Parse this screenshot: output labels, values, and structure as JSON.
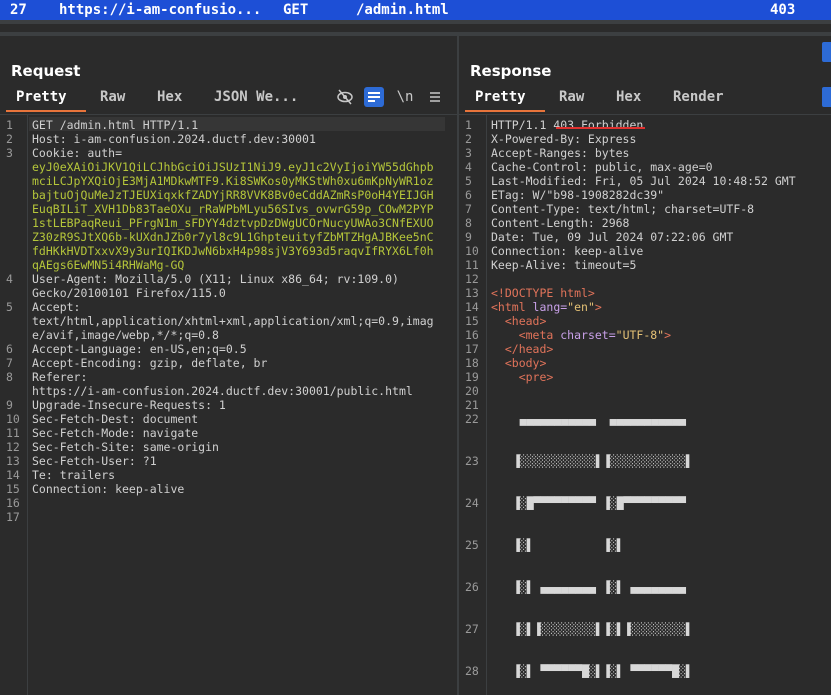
{
  "history_row": {
    "number": "27",
    "host": "https://i-am-confusio...",
    "method": "GET",
    "path": "/admin.html",
    "status": "403"
  },
  "request": {
    "title": "Request",
    "tabs": [
      "Pretty",
      "Raw",
      "Hex",
      "JSON We..."
    ],
    "active_tab": "Pretty",
    "icons": [
      "hide-icon",
      "wrap-lines-icon",
      "newline-icon",
      "menu-icon"
    ],
    "newline_glyph": "\\n",
    "lines": [
      {
        "n": "1",
        "text": "GET /admin.html HTTP/1.1"
      },
      {
        "n": "2",
        "text": "Host: i-am-confusion.2024.ductf.dev:30001"
      },
      {
        "n": "3",
        "text": "Cookie: auth="
      },
      {
        "n": "",
        "text": "eyJ0eXAiOiJKV1QiLCJhbGciOiJSUzI1NiJ9.eyJ1c2VyIjoiYW55dGhpb",
        "cookie": true
      },
      {
        "n": "",
        "text": "mciLCJpYXQiOjE3MjA1MDkwMTF9.Ki8SWKos0yMKStWh0xu6mKpNyWR1oz",
        "cookie": true
      },
      {
        "n": "",
        "text": "bajtuOjQuMeJzTJEUXiqxkfZADYjRR8VVK8Bv0eCddAZmRsP0oH4YEIJGH",
        "cookie": true
      },
      {
        "n": "",
        "text": "EuqBILiT_XVH1Db83TaeOXu_rRaWPbMLyu56SIvs_ovwrG59p_COwM2PYP",
        "cookie": true
      },
      {
        "n": "",
        "text": "1stLEBPaqReui_PFrgN1m_sFDYY4dztvpDzDWgUCOrNucyUWAo3CNfEXUO",
        "cookie": true
      },
      {
        "n": "",
        "text": "Z30zR9SJtXQ6b-kUXdnJZb0r7yl8c9L1GhpteuityfZbMTZHgAJBKee5nC",
        "cookie": true
      },
      {
        "n": "",
        "text": "fdHKkHVDTxxvX9y3urIQIKDJwN6bxH4p98sjV3Y693d5raqvIfRYX6Lf0h",
        "cookie": true
      },
      {
        "n": "",
        "text": "qAEgs6EwMN5i4RHWaMg-GQ",
        "cookie": true
      },
      {
        "n": "4",
        "text": "User-Agent: Mozilla/5.0 (X11; Linux x86_64; rv:109.0)"
      },
      {
        "n": "",
        "text": "Gecko/20100101 Firefox/115.0"
      },
      {
        "n": "5",
        "text": "Accept:"
      },
      {
        "n": "",
        "text": "text/html,application/xhtml+xml,application/xml;q=0.9,imag"
      },
      {
        "n": "",
        "text": "e/avif,image/webp,*/*;q=0.8"
      },
      {
        "n": "6",
        "text": "Accept-Language: en-US,en;q=0.5"
      },
      {
        "n": "7",
        "text": "Accept-Encoding: gzip, deflate, br"
      },
      {
        "n": "8",
        "text": "Referer:"
      },
      {
        "n": "",
        "text": "https://i-am-confusion.2024.ductf.dev:30001/public.html"
      },
      {
        "n": "9",
        "text": "Upgrade-Insecure-Requests: 1"
      },
      {
        "n": "10",
        "text": "Sec-Fetch-Dest: document"
      },
      {
        "n": "11",
        "text": "Sec-Fetch-Mode: navigate"
      },
      {
        "n": "12",
        "text": "Sec-Fetch-Site: same-origin"
      },
      {
        "n": "13",
        "text": "Sec-Fetch-User: ?1"
      },
      {
        "n": "14",
        "text": "Te: trailers"
      },
      {
        "n": "15",
        "text": "Connection: keep-alive"
      },
      {
        "n": "16",
        "text": ""
      },
      {
        "n": "17",
        "text": ""
      }
    ]
  },
  "response": {
    "title": "Response",
    "tabs": [
      "Pretty",
      "Raw",
      "Hex",
      "Render"
    ],
    "active_tab": "Pretty",
    "lines": [
      {
        "n": "1",
        "parts": [
          {
            "t": "HTTP/1.1 403 Forbidden",
            "c": "plain"
          }
        ]
      },
      {
        "n": "2",
        "parts": [
          {
            "t": "X-Powered-By: Express",
            "c": "plain"
          }
        ]
      },
      {
        "n": "3",
        "parts": [
          {
            "t": "Accept-Ranges: bytes",
            "c": "plain"
          }
        ]
      },
      {
        "n": "4",
        "parts": [
          {
            "t": "Cache-Control: public, max-age=0",
            "c": "plain"
          }
        ]
      },
      {
        "n": "5",
        "parts": [
          {
            "t": "Last-Modified: Fri, 05 Jul 2024 10:48:52 GMT",
            "c": "plain"
          }
        ]
      },
      {
        "n": "6",
        "parts": [
          {
            "t": "ETag: W/\"b98-1908282dc39\"",
            "c": "plain"
          }
        ]
      },
      {
        "n": "7",
        "parts": [
          {
            "t": "Content-Type: text/html; charset=UTF-8",
            "c": "plain"
          }
        ]
      },
      {
        "n": "8",
        "parts": [
          {
            "t": "Content-Length: 2968",
            "c": "plain"
          }
        ]
      },
      {
        "n": "9",
        "parts": [
          {
            "t": "Date: Tue, 09 Jul 2024 07:22:06 GMT",
            "c": "plain"
          }
        ]
      },
      {
        "n": "10",
        "parts": [
          {
            "t": "Connection: keep-alive",
            "c": "plain"
          }
        ]
      },
      {
        "n": "11",
        "parts": [
          {
            "t": "Keep-Alive: timeout=5",
            "c": "plain"
          }
        ]
      },
      {
        "n": "12",
        "parts": []
      },
      {
        "n": "13",
        "parts": [
          {
            "t": "<!DOCTYPE html>",
            "c": "tag"
          }
        ]
      },
      {
        "n": "14",
        "parts": [
          {
            "t": "<html ",
            "c": "tag"
          },
          {
            "t": "lang=",
            "c": "attr"
          },
          {
            "t": "\"en\"",
            "c": "str"
          },
          {
            "t": ">",
            "c": "tag"
          }
        ]
      },
      {
        "n": "15",
        "parts": [
          {
            "t": "  <head>",
            "c": "tag"
          }
        ]
      },
      {
        "n": "16",
        "parts": [
          {
            "t": "    <meta ",
            "c": "tag"
          },
          {
            "t": "charset=",
            "c": "attr"
          },
          {
            "t": "\"UTF-8\"",
            "c": "str"
          },
          {
            "t": ">",
            "c": "tag"
          }
        ]
      },
      {
        "n": "17",
        "parts": [
          {
            "t": "  </head>",
            "c": "tag"
          }
        ]
      },
      {
        "n": "18",
        "parts": [
          {
            "t": "  <body>",
            "c": "tag"
          }
        ]
      },
      {
        "n": "19",
        "parts": [
          {
            "t": "    <pre>",
            "c": "tag"
          }
        ]
      },
      {
        "n": "20",
        "parts": []
      },
      {
        "n": "21",
        "parts": []
      }
    ],
    "art_lines": [
      {
        "n": "22",
        "text": "   ▄▄▄▄▄▄▄▄▄▄▄  ▄▄▄▄▄▄▄▄▄▄▄"
      },
      {
        "n": "23",
        "text": "  ▐░░░░░░░░░░░▌▐░░░░░░░░░░░▌"
      },
      {
        "n": "24",
        "text": "  ▐░█▀▀▀▀▀▀▀▀▀ ▐░█▀▀▀▀▀▀▀▀▀"
      },
      {
        "n": "25",
        "text": "  ▐░▌          ▐░▌"
      },
      {
        "n": "26",
        "text": "  ▐░▌ ▄▄▄▄▄▄▄▄ ▐░▌ ▄▄▄▄▄▄▄▄"
      },
      {
        "n": "27",
        "text": "  ▐░▌▐░░░░░░░░▌▐░▌▐░░░░░░░░▌"
      },
      {
        "n": "28",
        "text": "  ▐░▌ ▀▀▀▀▀▀█░▌▐░▌ ▀▀▀▀▀▀█░▌"
      }
    ]
  },
  "colors": {
    "history_selected": "#1d4fd6",
    "active_tab_underline": "#e8743b",
    "cookie_text": "#b5c63a",
    "annotation_underline": "#e0312f"
  }
}
